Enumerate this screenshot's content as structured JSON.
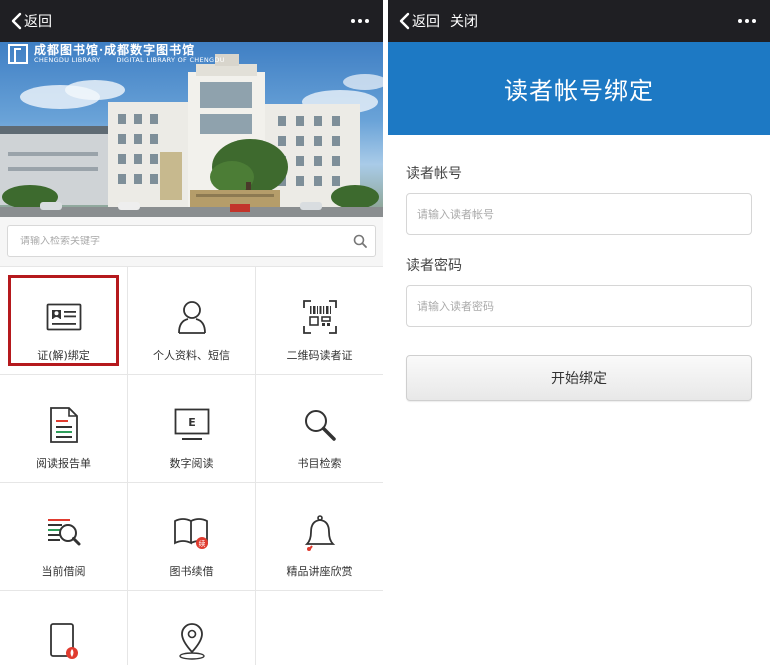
{
  "left": {
    "nav": {
      "back_label": "返回"
    },
    "banner": {
      "logo_cn": "成都图书馆·成都数字图书馆",
      "logo_en_1": "CHENGDU LIBRARY",
      "logo_en_2": "DIGITAL LIBRARY OF CHENGDU"
    },
    "search": {
      "placeholder": "请输入检索关键字"
    },
    "menu": [
      {
        "label": "证(解)绑定",
        "icon": "id-card-icon",
        "highlighted": true
      },
      {
        "label": "个人资料、短信",
        "icon": "user-icon"
      },
      {
        "label": "二维码读者证",
        "icon": "qr-code-icon"
      },
      {
        "label": "阅读报告单",
        "icon": "report-document-icon"
      },
      {
        "label": "数字阅读",
        "icon": "e-reader-icon"
      },
      {
        "label": "书目检索",
        "icon": "magnifier-icon"
      },
      {
        "label": "当前借阅",
        "icon": "borrow-list-search-icon"
      },
      {
        "label": "图书续借",
        "icon": "book-renew-icon"
      },
      {
        "label": "精品讲座欣赏",
        "icon": "bell-icon"
      },
      {
        "label": "",
        "icon": "ebook-fire-icon"
      },
      {
        "label": "",
        "icon": "location-pin-icon"
      }
    ],
    "colors": {
      "highlight_border": "#b5191d",
      "navbar": "#1f1f23",
      "badge_red": "#e03b2f"
    }
  },
  "right": {
    "nav": {
      "back_label": "返回",
      "close_label": "关闭"
    },
    "title": "读者帐号绑定",
    "account": {
      "label": "读者帐号",
      "placeholder": "请输入读者帐号"
    },
    "password": {
      "label": "读者密码",
      "placeholder": "请输入读者密码"
    },
    "submit_label": "开始绑定",
    "colors": {
      "title_band": "#1d79c4"
    }
  }
}
